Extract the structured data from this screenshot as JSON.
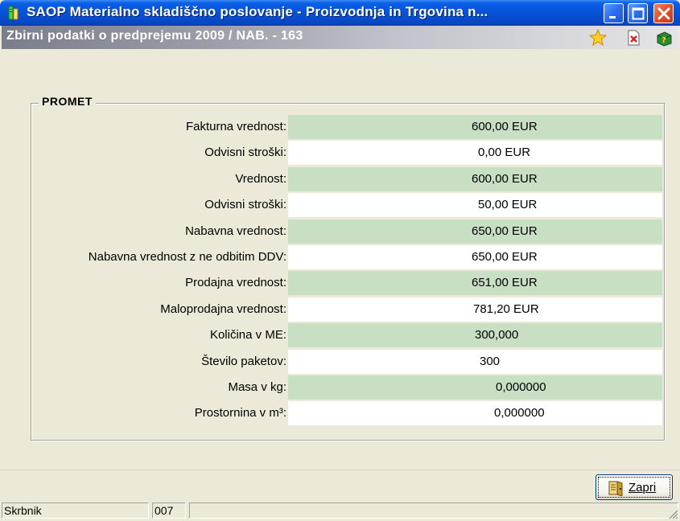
{
  "window": {
    "title": "SAOP Materialno skladiščno poslovanje - Proizvodnja in Trgovina n...",
    "subtitle": "Zbirni podatki o predprejemu 2009 / NAB. - 163"
  },
  "toolbar_icons": [
    "favorite-star-icon",
    "close-document-icon",
    "help-icon"
  ],
  "group": {
    "title": "PROMET",
    "rows": [
      {
        "label": "Fakturna vrednost:",
        "value": "600,00 EUR",
        "shaded": true
      },
      {
        "label": "Odvisni stroški:",
        "value": "0,00 EUR",
        "shaded": false
      },
      {
        "label": "Vrednost:",
        "value": "600,00 EUR",
        "shaded": true
      },
      {
        "label": "Odvisni stroški:",
        "value": "50,00 EUR",
        "shaded": false
      },
      {
        "label": "Nabavna vrednost:",
        "value": "650,00 EUR",
        "shaded": true
      },
      {
        "label": "Nabavna vrednost z ne odbitim DDV:",
        "value": "650,00 EUR",
        "shaded": false
      },
      {
        "label": "Prodajna vrednost:",
        "value": "651,00 EUR",
        "shaded": true
      },
      {
        "label": "Maloprodajna vrednost:",
        "value": "781,20 EUR",
        "shaded": false
      },
      {
        "label": "Količina v ME:",
        "value": "300,000",
        "shaded": true
      },
      {
        "label": "Število paketov:",
        "value": "300",
        "shaded": false
      },
      {
        "label": "Masa v kg:",
        "value": "0,000000",
        "shaded": true
      },
      {
        "label": "Prostornina v m³:",
        "value": "0,000000",
        "shaded": false
      }
    ]
  },
  "buttons": {
    "close_label": "Zapri"
  },
  "status_bar": {
    "user": "Skrbnik",
    "code": "007",
    "extra": ""
  },
  "colors": {
    "titlebar": "#0653d8",
    "shaded_row": "#c8dfc4",
    "background": "#ece9d8"
  }
}
